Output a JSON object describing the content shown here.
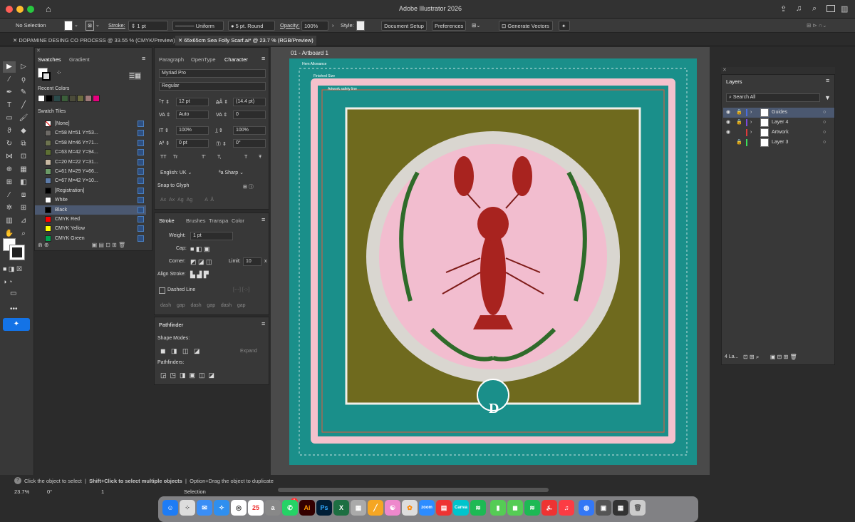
{
  "app": {
    "title": "Adobe Illustrator 2026"
  },
  "control": {
    "selection": "No Selection",
    "stroke_label": "Stroke:",
    "stroke_weight": "1 pt",
    "profile": "Uniform",
    "brush": "5 pt. Round",
    "opacity_label": "Opacity:",
    "opacity": "100%",
    "style_label": "Style:",
    "document_setup": "Document Setup",
    "preferences": "Preferences",
    "generate_vectors": "Generate Vectors"
  },
  "tabs": [
    {
      "label": "DOPAMINE DESING CO PROCESS @ 33.55 % (CMYK/Preview)"
    },
    {
      "label": "65x65cm Sea Folly Scarf.ai* @ 23.7 % (RGB/Preview)"
    }
  ],
  "swatches": {
    "tab1": "Swatches",
    "tab2": "Gradient",
    "recent": "Recent Colors",
    "tiles": "Swatch Tiles",
    "recent_colors": [
      "#ffffff",
      "#000000",
      "#2b4a4a",
      "#3b5e3a",
      "#4b4b3a",
      "#6b6b3e",
      "#a07a7a",
      "#e6007e"
    ],
    "items": [
      {
        "name": "[None]",
        "color": "#ffffff"
      },
      {
        "name": "C=58 M=51 Y=53...",
        "color": "#6d6a66"
      },
      {
        "name": "C=58 M=46 Y=71...",
        "color": "#6d734f"
      },
      {
        "name": "C=63 M=42 Y=94...",
        "color": "#5e7034"
      },
      {
        "name": "C=20 M=22 Y=31...",
        "color": "#c9b9a3"
      },
      {
        "name": "C=61 M=29 Y=66...",
        "color": "#6c9a67"
      },
      {
        "name": "C=67 M=42 Y=10...",
        "color": "#5d7ca9"
      },
      {
        "name": "[Registration]",
        "color": "#000000"
      },
      {
        "name": "White",
        "color": "#ffffff"
      },
      {
        "name": "Black",
        "color": "#000000"
      },
      {
        "name": "CMYK Red",
        "color": "#ff0000"
      },
      {
        "name": "CMYK Yellow",
        "color": "#ffff00"
      },
      {
        "name": "CMYK Green",
        "color": "#00a651"
      }
    ]
  },
  "character": {
    "tab1": "Paragraph",
    "tab2": "OpenType",
    "tab3": "Character",
    "font": "Myriad Pro",
    "style": "Regular",
    "size": "12 pt",
    "leading": "(14.4 pt)",
    "kerning": "Auto",
    "tracking": "0",
    "vscale": "100%",
    "hscale": "100%",
    "baseline": "0 pt",
    "rotation": "0°",
    "tt1": "TT",
    "tt2": "Tr",
    "tt3": "T'",
    "tt4": "T,",
    "tt5": "T",
    "tt6": "Ŧ",
    "language": "English: UK",
    "aa": "Sharp",
    "aa_prefix": "ªa",
    "snap": "Snap to Glyph"
  },
  "stroke": {
    "tab1": "Stroke",
    "tab2": "Brushes",
    "tab3": "Transpa",
    "tab4": "Color",
    "weight_label": "Weight:",
    "weight": "1 pt",
    "cap_label": "Cap:",
    "corner_label": "Corner:",
    "limit_label": "Limit:",
    "limit": "10",
    "limit_x": "x",
    "align_label": "Align Stroke:",
    "dashed": "Dashed Line",
    "dash": "dash",
    "gap": "gap"
  },
  "pathfinder": {
    "title": "Pathfinder",
    "shape_modes": "Shape Modes:",
    "expand": "Expand",
    "pathfinders": "Pathfinders:"
  },
  "artboard": {
    "label": "01 - Artboard 1",
    "hem": "Hem Allowance",
    "finished": "Finished Size",
    "safety": "Artwork safety line",
    "logo_letter": "D"
  },
  "layers": {
    "title": "Layers",
    "search": "Search All",
    "items": [
      {
        "name": "Guides",
        "color": "#4a6ee0"
      },
      {
        "name": "Layer 4",
        "color": "#7a4ae0"
      },
      {
        "name": "Artwork",
        "color": "#e03a3a"
      },
      {
        "name": "Layer 3",
        "color": "#3ae05a"
      }
    ],
    "count": "4 La..."
  },
  "status": {
    "hint1": "Click the object to select",
    "hint2": "Shift+Click to select multiple objects",
    "hint3": "Option+Drag the object to duplicate",
    "zoom": "23.7%",
    "angle": "0°",
    "page": "1",
    "mode": "Selection"
  },
  "dock": {
    "calendar_day": "25",
    "badge": "1"
  }
}
